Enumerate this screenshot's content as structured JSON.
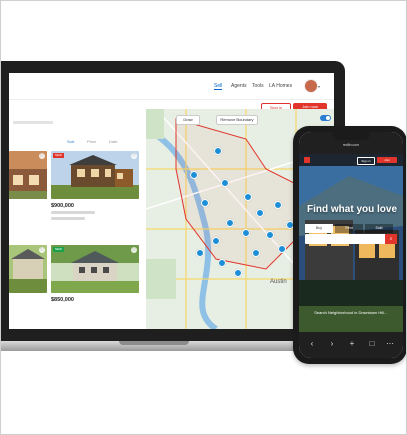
{
  "laptop": {
    "nav": {
      "links": [
        "Sell",
        "Agents",
        "Tools",
        "LA Homes"
      ],
      "avatar_caret": "▾"
    },
    "buttons": {
      "sign_in": "Sign in",
      "sign_up": "Join now"
    },
    "map_controls": {
      "draw": "Draw",
      "remove": "Remove Boundary"
    },
    "sort": {
      "label": "Sort",
      "a": "Price",
      "b": "Date"
    },
    "listings": [
      {
        "price": "$900,000",
        "tag": "NEW"
      },
      {
        "price": "$850,000",
        "tag": "NEW"
      }
    ],
    "map": {
      "city": "Austin"
    }
  },
  "phone": {
    "url": "redfin.com",
    "header": {
      "btn1": "Sign in",
      "btn2": "Join"
    },
    "headline": "Find what you love",
    "tabs": [
      "Buy",
      "Rent",
      "Sold"
    ],
    "search": {
      "go_icon": "magnifier-icon"
    },
    "caption": "Search Neighborhood in Downtown Hill…",
    "bottom_icons": [
      "‹",
      "›",
      "+",
      "□",
      "⋯"
    ]
  },
  "colors": {
    "accent": "#e1342b",
    "link": "#2b7cd3",
    "map_pin": "#1e8fd6"
  }
}
